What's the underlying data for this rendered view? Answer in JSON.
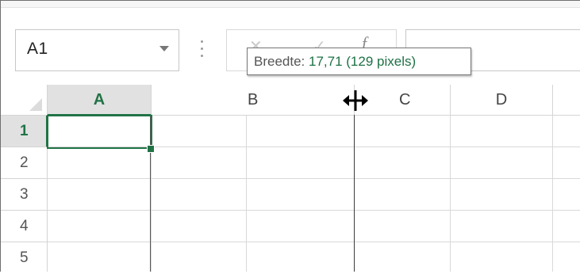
{
  "name_box": {
    "value": "A1"
  },
  "formula_bar": {
    "cancel_icon": "close-icon",
    "enter_icon": "check-icon",
    "fx_label": "f",
    "value": ""
  },
  "tooltip": {
    "label": "Breedte: ",
    "value": "17,71 (129 pixels)"
  },
  "columns": [
    "A",
    "B",
    "C",
    "D"
  ],
  "rows": [
    "1",
    "2",
    "3",
    "4",
    "5"
  ],
  "selected_cell": "A1",
  "colors": {
    "accent": "#217346",
    "header_active_bg": "#e1e1e1",
    "grid_line": "#d9d9d9"
  },
  "cursor_icon": "column-resize-cursor-icon"
}
